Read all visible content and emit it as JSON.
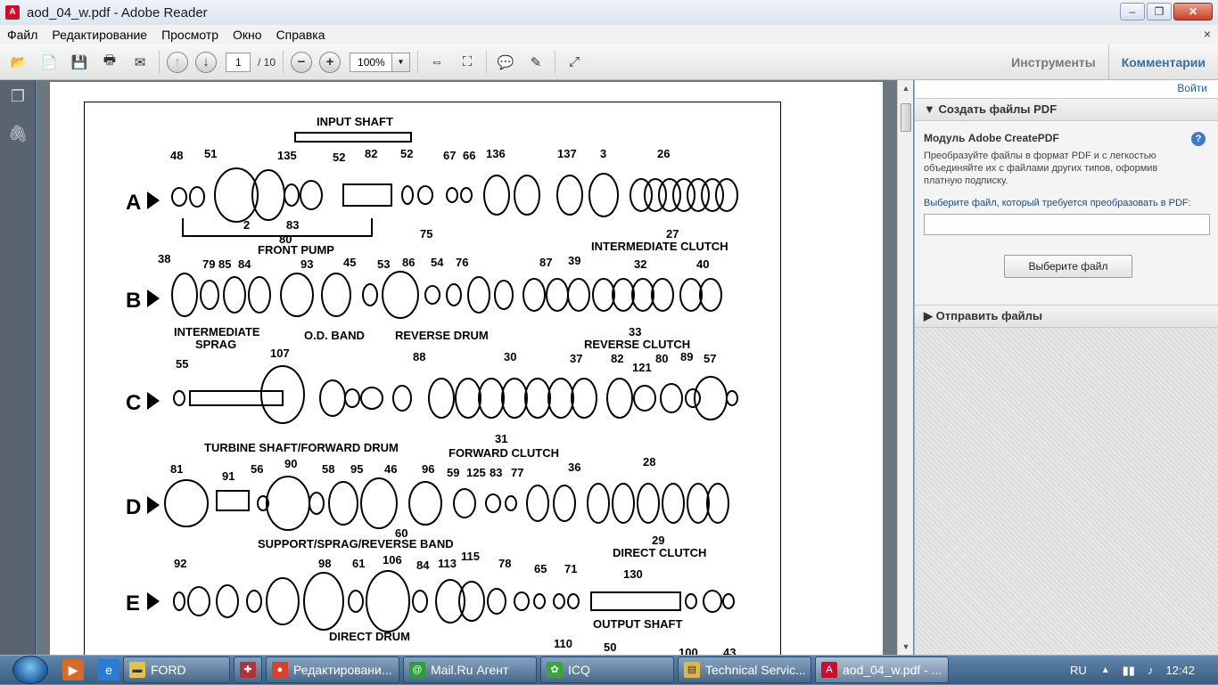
{
  "window": {
    "title": "aod_04_w.pdf - Adobe Reader",
    "app_icon": "pdf-icon",
    "min": "–",
    "max": "❐",
    "close": "✕"
  },
  "menu": {
    "items": [
      "Файл",
      "Редактирование",
      "Просмотр",
      "Окно",
      "Справка"
    ],
    "close": "×"
  },
  "toolbar": {
    "page_current": "1",
    "page_total": "/ 10",
    "zoom": "100%",
    "tools_label": "Инструменты",
    "comments_label": "Комментарии"
  },
  "right_panel": {
    "login": "Войти",
    "section1_title": "Создать файлы PDF",
    "module_title": "Модуль Adobe CreatePDF",
    "description": "Преобразуйте файлы в формат PDF и с легкостью объединяйте их с файлами других типов, оформив платную подписку.",
    "prompt": "Выберите файл, который требуется преобразовать в PDF:",
    "choose_button": "Выберите файл",
    "section2_title": "Отправить файлы"
  },
  "document": {
    "row_letters": [
      "A",
      "B",
      "C",
      "D",
      "E"
    ],
    "captions": {
      "input_shaft": "INPUT SHAFT",
      "front_pump": "FRONT PUMP",
      "intermediate_clutch": "INTERMEDIATE CLUTCH",
      "intermediate": "INTERMEDIATE",
      "sprag": "SPRAG",
      "od_band": "O.D. BAND",
      "reverse_drum": "REVERSE DRUM",
      "reverse_clutch": "REVERSE CLUTCH",
      "turbine_shaft": "TURBINE SHAFT/FORWARD DRUM",
      "forward_clutch": "FORWARD CLUTCH",
      "support_sprag": "SUPPORT/SPRAG/REVERSE BAND",
      "direct_clutch": "DIRECT CLUTCH",
      "direct_drum": "DIRECT DRUM",
      "output_shaft": "OUTPUT SHAFT"
    },
    "part_numbers": {
      "row_a": [
        "48",
        "51",
        "135",
        "52",
        "82",
        "52",
        "67",
        "66",
        "136",
        "137",
        "3",
        "26",
        "2",
        "83",
        "80",
        "75",
        "27"
      ],
      "row_b": [
        "38",
        "79",
        "85",
        "84",
        "93",
        "45",
        "53",
        "86",
        "54",
        "76",
        "87",
        "39",
        "32",
        "40",
        "33"
      ],
      "row_c": [
        "55",
        "107",
        "88",
        "30",
        "37",
        "82",
        "121",
        "80",
        "89",
        "57",
        "31"
      ],
      "row_d": [
        "81",
        "91",
        "56",
        "90",
        "58",
        "95",
        "46",
        "96",
        "59",
        "125",
        "83",
        "77",
        "36",
        "28",
        "60",
        "29"
      ],
      "row_e": [
        "92",
        "98",
        "61",
        "106",
        "84",
        "113",
        "115",
        "78",
        "65",
        "71",
        "130",
        "110",
        "50",
        "100",
        "43"
      ]
    }
  },
  "taskbar": {
    "items": [
      "FORD",
      "Редактировани...",
      "Mail.Ru Агент",
      "ICQ",
      "Technical Servic...",
      "aod_04_w.pdf - ..."
    ],
    "lang": "RU",
    "clock": "12:42"
  }
}
